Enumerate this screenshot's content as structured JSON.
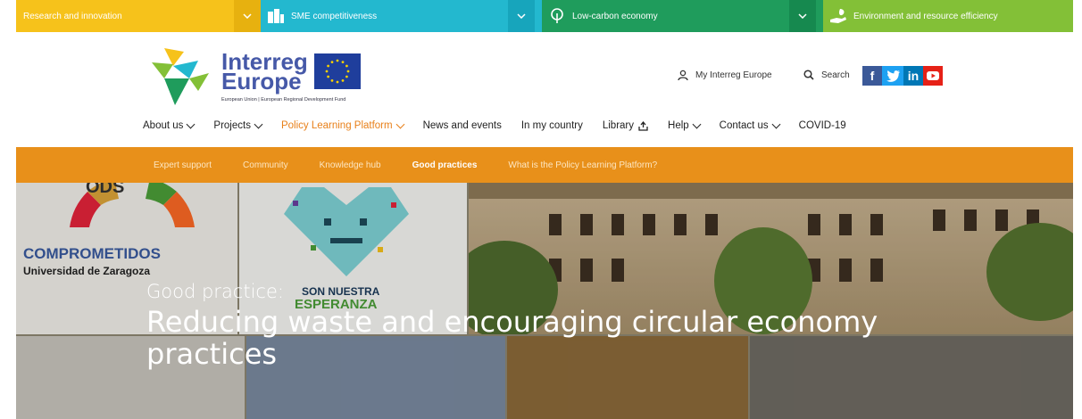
{
  "topics": [
    {
      "label": "Research and innovation",
      "icon": "chevron-down-icon",
      "color": "#f6c21b"
    },
    {
      "label": "SME competitiveness",
      "icon": "buildings-icon",
      "color": "#23b8cf"
    },
    {
      "label": "Low-carbon economy",
      "icon": "tree-icon",
      "color": "#1f9c5c"
    },
    {
      "label": "Environment and resource efficiency",
      "icon": "hand-leaf-icon",
      "color": "#83c037"
    }
  ],
  "brand": {
    "line1": "Interreg",
    "line2": "Europe",
    "tagline": "European Union | European Regional Development Fund"
  },
  "utility": {
    "my_interreg": "My Interreg Europe",
    "search": "Search"
  },
  "social": [
    {
      "label": "f",
      "icon": "facebook-icon",
      "color": "#3b5998"
    },
    {
      "label": "t",
      "icon": "twitter-icon",
      "color": "#1da1f2"
    },
    {
      "label": "in",
      "icon": "linkedin-icon",
      "color": "#0077b5"
    },
    {
      "label": "▶",
      "icon": "youtube-icon",
      "color": "#e62117"
    }
  ],
  "mainnav": [
    {
      "label": "About us",
      "dropdown": true
    },
    {
      "label": "Projects",
      "dropdown": true
    },
    {
      "label": "Policy Learning Platform",
      "dropdown": true,
      "active": true
    },
    {
      "label": "News and events",
      "dropdown": false
    },
    {
      "label": "In my country",
      "dropdown": false
    },
    {
      "label": "Library",
      "dropdown": false,
      "external": true
    },
    {
      "label": "Help",
      "dropdown": true
    },
    {
      "label": "Contact us",
      "dropdown": true
    },
    {
      "label": "COVID-19",
      "dropdown": false
    }
  ],
  "subnav": [
    {
      "label": "Expert support"
    },
    {
      "label": "Community"
    },
    {
      "label": "Knowledge hub"
    },
    {
      "label": "Good practices",
      "active": true
    },
    {
      "label": "What is the Policy Learning Platform?"
    }
  ],
  "hero": {
    "kicker": "Good practice:",
    "title": "Reducing waste and encouraging circular economy practices",
    "collage": {
      "ods_text": "ODS",
      "comprometidos": "COMPROMETIDOS",
      "university": "Universidad de Zaragoza",
      "son_nuestra": "SON NUESTRA",
      "esperanza": "ESPERANZA"
    }
  }
}
